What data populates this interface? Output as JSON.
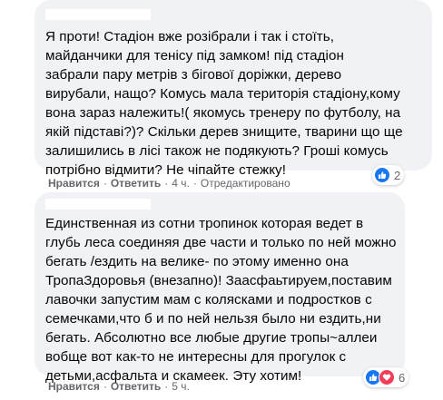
{
  "comments": [
    {
      "text": "Я проти! Стадіон вже розібрали і так і стоїть,\nмайданчики для тенісу під замком! під стадіон\nзабрали пару метрів з бігової доріжки, дерево\nвирубали, нащо? Комусь мала територія стадіону,кому\nвона зараз належить!( якомусь тренеру по футболу, на\nякій підставі?)? Скільки дерев знищите, тварини що ще\nзалишились в лісі також не подякують? Гроші комусь\nпотрібно відмити? Не чіпайте стежку!",
      "reactions": {
        "icons": [
          "like-icon"
        ],
        "count": "2"
      },
      "actions": {
        "like": "Нравится",
        "reply": "Ответить",
        "time": "4 ч.",
        "edited": "Отредактировано"
      }
    },
    {
      "text": "Единственная из сотни тропинок которая ведет в\nглубь леса соединяя две части и только по ней можно\nбегать /ездить на велике- по этому именно она\nТропаЗдоровья (внезапно)! Заасфаьтируем,поставим\nлавочки запустим мам с колясками и подростков с\nсемечками,что б и по ней нельзя было ни ездить,ни\nбегать. Абсолютно все любые другие тропы~аллеи\nвобще вот как-то не интересны для прогулок с\nдетьми,асфальта и скамеек. Эту хотим!",
      "reactions": {
        "icons": [
          "like-icon",
          "love-icon"
        ],
        "count": "6"
      },
      "actions": {
        "like": "Нравится",
        "reply": "Ответить",
        "time": "5 ч."
      }
    }
  ],
  "colors": {
    "bubble": "#f0f2f5",
    "like_blue": "#1877f2",
    "love_red": "#f33e58",
    "meta_gray": "#65676b"
  }
}
